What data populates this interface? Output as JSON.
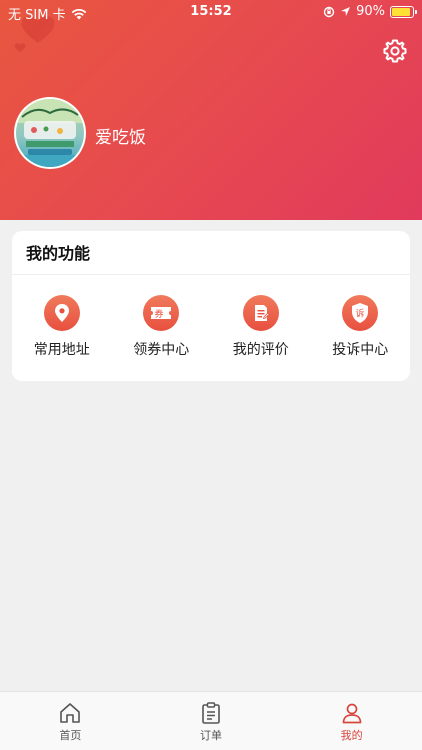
{
  "status_bar": {
    "carrier": "无 SIM 卡",
    "time": "15:52",
    "battery": "90%",
    "battery_level": 0.9,
    "icons": [
      "wifi-icon",
      "orientation-lock-icon",
      "location-arrow-icon",
      "battery-icon"
    ]
  },
  "header": {
    "username": "爱吃饭",
    "settings_icon": "gear-icon",
    "gradient": [
      "#e8573f",
      "#e13a5c"
    ]
  },
  "functions": {
    "title": "我的功能",
    "items": [
      {
        "label": "常用地址",
        "icon": "location-pin-icon"
      },
      {
        "label": "领券中心",
        "icon": "coupon-icon",
        "glyph": "券"
      },
      {
        "label": "我的评价",
        "icon": "review-icon"
      },
      {
        "label": "投诉中心",
        "icon": "complaint-icon",
        "glyph": "诉"
      }
    ]
  },
  "tabbar": {
    "items": [
      {
        "label": "首页",
        "icon": "home-icon"
      },
      {
        "label": "订单",
        "icon": "order-clipboard-icon"
      },
      {
        "label": "我的",
        "icon": "profile-icon",
        "active": true
      }
    ]
  },
  "colors": {
    "accent": "#d8453f",
    "icon_bg": "#e8503f",
    "page_bg": "#f0f0f0"
  }
}
